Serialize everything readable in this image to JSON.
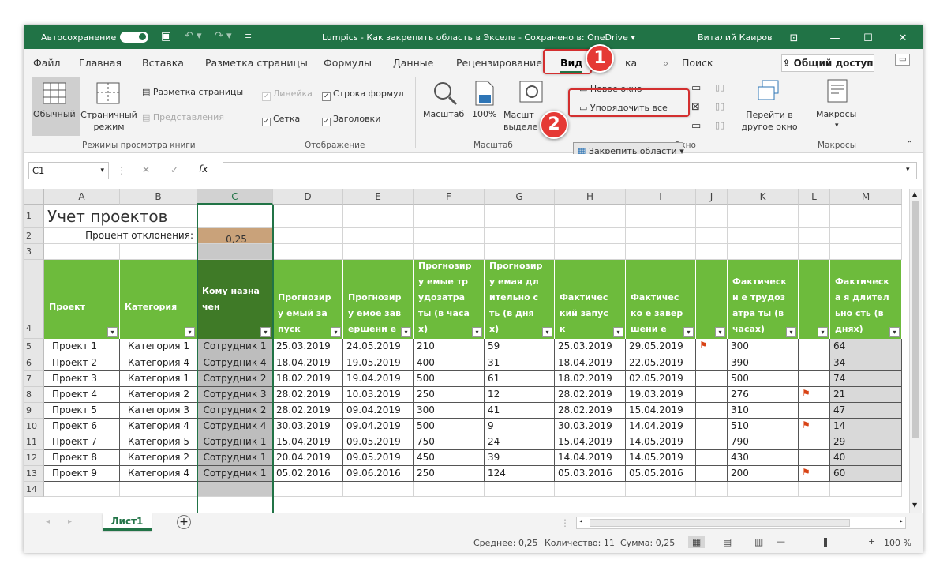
{
  "titlebar": {
    "autosave": "Автосохранение",
    "doc": "Lumpics - Как закрепить область в Экселе  -  Сохранено в: OneDrive ▾",
    "user": "Виталий Каиров"
  },
  "tabs": [
    "Файл",
    "Главная",
    "Вставка",
    "Разметка страницы",
    "Формулы",
    "Данные",
    "Рецензирование",
    "Вид",
    "ка",
    "Поиск"
  ],
  "share_label": "Общий доступ",
  "ribbon": {
    "normal": "Обычный",
    "page_break": "Страничный режим",
    "page_layout": "Разметка страницы",
    "custom_views": "Представления",
    "ruler": "Линейка",
    "formula_bar": "Строка формул",
    "gridlines": "Сетка",
    "headings": "Заголовки",
    "zoom": "Масштаб",
    "zoom100": "100%",
    "zoom_sel": "Масшт выделе",
    "new_window": "Новое окно",
    "arrange": "Упорядочить все",
    "freeze": "Закрепить области",
    "switch_windows": "Перейти в другое окно",
    "macros": "Макросы",
    "grp_views": "Режимы просмотра книги",
    "grp_show": "Отображение",
    "grp_zoom": "Масштаб",
    "grp_window": "Окно",
    "grp_macros": "Макросы"
  },
  "badges": {
    "one": "1",
    "two": "2"
  },
  "namebox": "C1",
  "fx": "fx",
  "columns": [
    "A",
    "B",
    "C",
    "D",
    "E",
    "F",
    "G",
    "H",
    "I",
    "J",
    "K",
    "L",
    "M"
  ],
  "rows": [
    "1",
    "2",
    "3",
    "4",
    "5",
    "6",
    "7",
    "8",
    "9",
    "10",
    "11",
    "12",
    "13",
    "14"
  ],
  "sheet_title": "Учет проектов",
  "deviation_label": "Процент отклонения:",
  "deviation_value": "0,25",
  "headers": [
    "Проект",
    "Категория",
    "Кому назначен",
    "Прогнозиру емый запуск",
    "Прогнозиру емое завершени е",
    "Прогнозиру емые трудозатра ты (в часах)",
    "Прогнозиру емая длительно сть (в днях)",
    "Фактичес кий запуск",
    "Фактическо е завершени е",
    "",
    "Фактически е трудозатра ты (в часах)",
    "",
    "Фактическа я длительно сть (в днях)"
  ],
  "table": [
    [
      "Проект 1",
      "Категория 1",
      "Сотрудник 1",
      "25.03.2019",
      "24.05.2019",
      "210",
      "59",
      "25.03.2019",
      "29.05.2019",
      "",
      "300",
      "",
      "64"
    ],
    [
      "Проект 2",
      "Категория 4",
      "Сотрудник 4",
      "18.04.2019",
      "19.05.2019",
      "400",
      "31",
      "18.04.2019",
      "22.05.2019",
      "",
      "390",
      "",
      "34"
    ],
    [
      "Проект 3",
      "Категория 1",
      "Сотрудник 2",
      "18.02.2019",
      "19.04.2019",
      "500",
      "61",
      "18.02.2019",
      "02.05.2019",
      "",
      "500",
      "",
      "74"
    ],
    [
      "Проект 4",
      "Категория 2",
      "Сотрудник 3",
      "28.02.2019",
      "10.03.2019",
      "250",
      "12",
      "28.02.2019",
      "19.03.2019",
      "",
      "276",
      "",
      "21"
    ],
    [
      "Проект 5",
      "Категория 3",
      "Сотрудник 2",
      "28.02.2019",
      "09.04.2019",
      "300",
      "41",
      "28.02.2019",
      "15.04.2019",
      "",
      "310",
      "",
      "47"
    ],
    [
      "Проект 6",
      "Категория 4",
      "Сотрудник 4",
      "30.03.2019",
      "09.04.2019",
      "500",
      "9",
      "30.03.2019",
      "14.04.2019",
      "",
      "510",
      "",
      "14"
    ],
    [
      "Проект 7",
      "Категория 5",
      "Сотрудник 1",
      "15.04.2019",
      "09.05.2019",
      "750",
      "24",
      "15.04.2019",
      "14.05.2019",
      "",
      "790",
      "",
      "29"
    ],
    [
      "Проект 8",
      "Категория 2",
      "Сотрудник 1",
      "20.04.2019",
      "09.05.2019",
      "450",
      "39",
      "14.04.2019",
      "14.05.2019",
      "",
      "430",
      "",
      "40"
    ],
    [
      "Проект 9",
      "Категория 4",
      "Сотрудник 1",
      "05.02.2016",
      "09.06.2016",
      "250",
      "124",
      "05.03.2016",
      "05.05.2016",
      "",
      "200",
      "",
      "60"
    ]
  ],
  "sheet_tab": "Лист1",
  "status": {
    "avg": "Среднее: 0,25",
    "count": "Количество: 11",
    "sum": "Сумма: 0,25",
    "zoom": "100 %"
  },
  "colors": {
    "excel_green": "#217346",
    "header_green": "#6dbb3c",
    "accent_red": "#d32f2f"
  }
}
